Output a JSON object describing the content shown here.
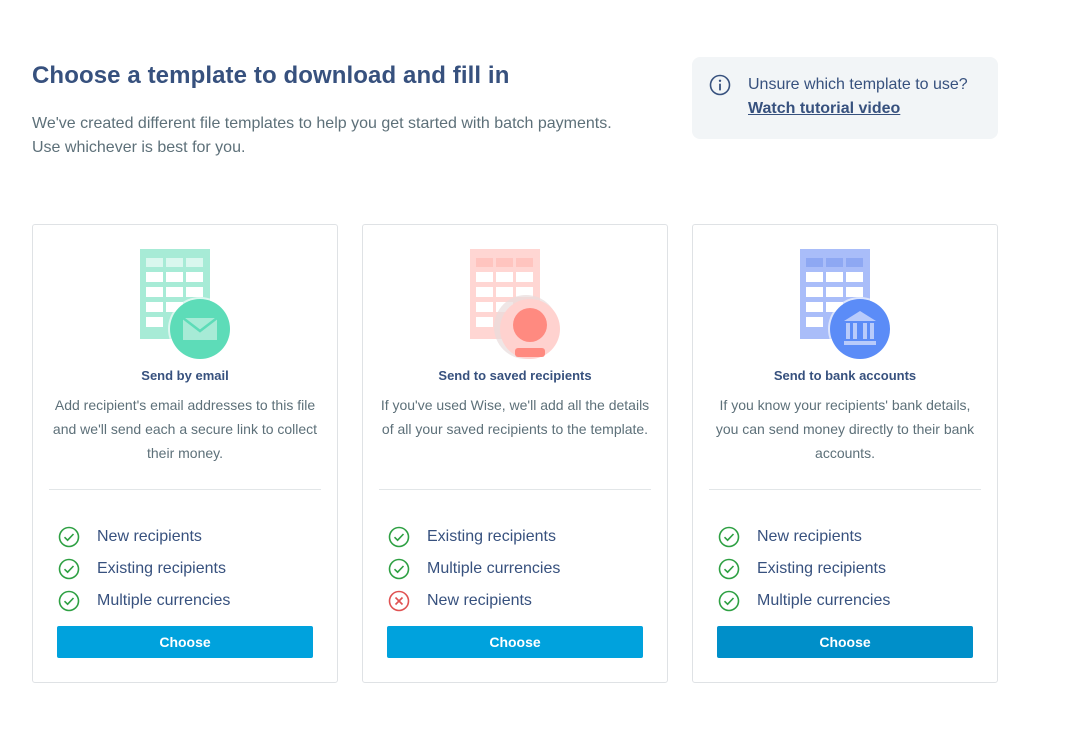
{
  "header": {
    "title": "Choose a template to download and fill in",
    "subtitle": "We've created different file templates to help you get started with batch payments. Use whichever is best for you."
  },
  "info": {
    "icon": "info-icon",
    "question": "Unsure which template to use?",
    "link": "Watch tutorial video"
  },
  "cards": [
    {
      "title": "Send by email",
      "description": "Add recipient's email addresses to this file and we'll send each a secure link to collect their money.",
      "illustration": "spreadsheet-email-icon",
      "accent": "#5ddcb8",
      "features": [
        {
          "label": "New recipients",
          "status": "check"
        },
        {
          "label": "Existing recipients",
          "status": "check"
        },
        {
          "label": "Multiple currencies",
          "status": "check"
        }
      ],
      "button": "Choose"
    },
    {
      "title": "Send to saved recipients",
      "description": "If you've used Wise, we'll add all the details of all your saved recipients to the template.",
      "illustration": "spreadsheet-person-icon",
      "accent": "#ff8a80",
      "features": [
        {
          "label": "Existing recipients",
          "status": "check"
        },
        {
          "label": "Multiple currencies",
          "status": "check"
        },
        {
          "label": "New recipients",
          "status": "cross"
        }
      ],
      "button": "Choose"
    },
    {
      "title": "Send to bank accounts",
      "description": "If you know your recipients' bank details, you can send money directly to their bank accounts.",
      "illustration": "spreadsheet-bank-icon",
      "accent": "#5b8cf7",
      "features": [
        {
          "label": "New recipients",
          "status": "check"
        },
        {
          "label": "Existing recipients",
          "status": "check"
        },
        {
          "label": "Multiple currencies",
          "status": "check"
        }
      ],
      "button": "Choose"
    }
  ],
  "colors": {
    "primary_button": "#00a2dd",
    "check": "#2ea043",
    "cross": "#e05252",
    "heading": "#37517e",
    "body_text": "#5d7079"
  }
}
